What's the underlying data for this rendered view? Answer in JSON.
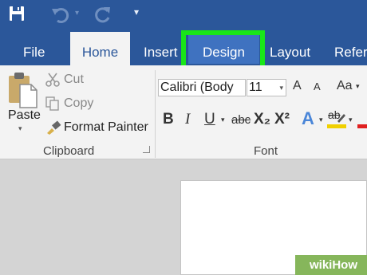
{
  "quick_access": {
    "save_icon": "save-icon",
    "undo_icon": "undo-icon",
    "redo_icon": "redo-icon",
    "customize_icon": "chevron-down-icon"
  },
  "tabs": [
    {
      "label": "File"
    },
    {
      "label": "Home",
      "active": true
    },
    {
      "label": "Insert"
    },
    {
      "label": "Design",
      "highlighted": true
    },
    {
      "label": "Layout"
    },
    {
      "label": "Refer"
    }
  ],
  "clipboard": {
    "paste_label": "Paste",
    "cut_label": "Cut",
    "copy_label": "Copy",
    "format_painter_label": "Format Painter",
    "group_label": "Clipboard"
  },
  "font": {
    "font_name": "Calibri (Body",
    "font_size": "11",
    "grow_label": "A",
    "shrink_label": "A",
    "case_label": "Aa",
    "bold_label": "B",
    "italic_label": "I",
    "underline_label": "U",
    "strike_label": "abc",
    "subscript_label": "X₂",
    "superscript_label": "X²",
    "effects_label": "A",
    "highlight_label": "ab",
    "group_label": "Font"
  },
  "watermark": {
    "text": "wikiHow"
  },
  "colors": {
    "ribbon_blue": "#2b579a",
    "highlight_green": "#19e619",
    "design_tab": "#3f72c0",
    "highlight_yellow": "#f0d000",
    "font_color_red": "#e02020"
  }
}
